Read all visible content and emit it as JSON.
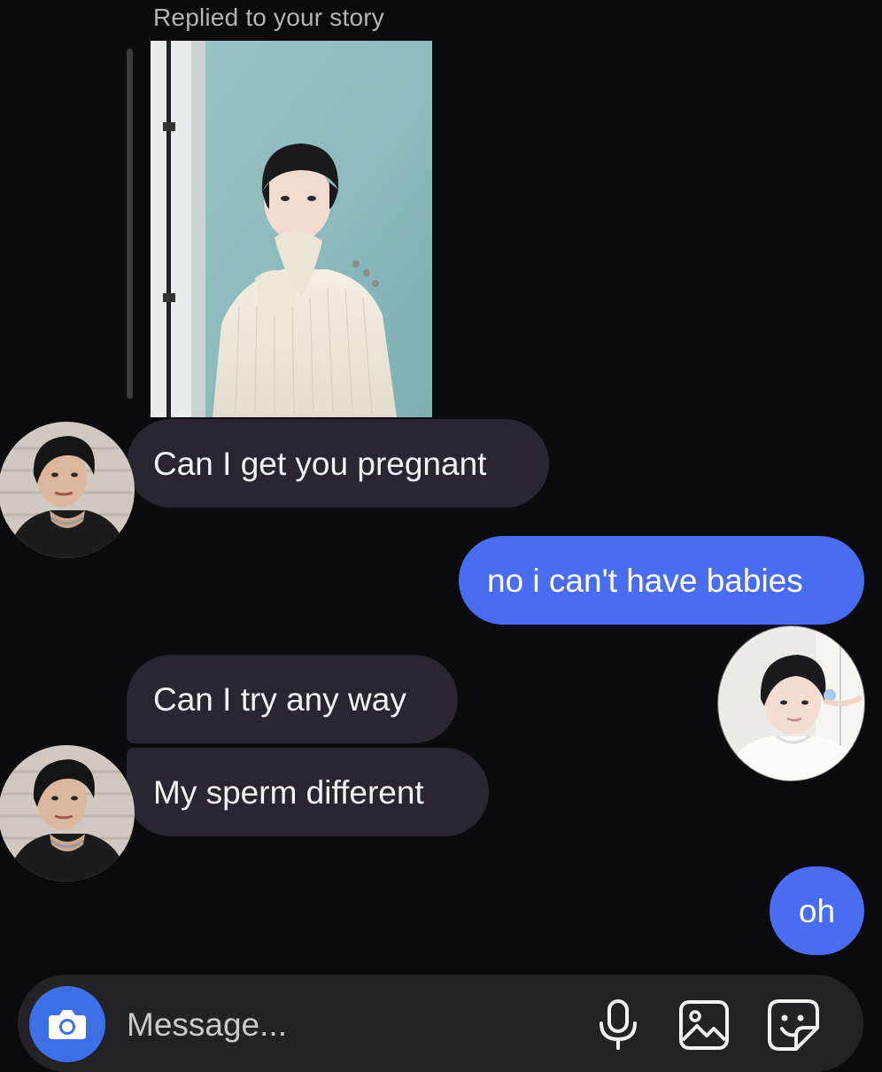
{
  "reply_label": "Replied to your story",
  "messages": [
    {
      "sender": "them",
      "text": "Can I get you pregnant"
    },
    {
      "sender": "me",
      "text": "no i can't have babies"
    },
    {
      "sender": "them",
      "text": "Can I try any way"
    },
    {
      "sender": "them",
      "text": "My sperm different"
    },
    {
      "sender": "me",
      "text": "oh"
    }
  ],
  "composer": {
    "placeholder": "Message...",
    "icons": [
      "camera-icon",
      "microphone-icon",
      "gallery-icon",
      "sticker-icon"
    ]
  },
  "colors": {
    "background": "#0b0b0d",
    "incoming_bubble": "#2a2630",
    "outgoing_bubble": "#4a6cf0",
    "camera_button": "#3d6fe6",
    "composer": "#232227"
  }
}
